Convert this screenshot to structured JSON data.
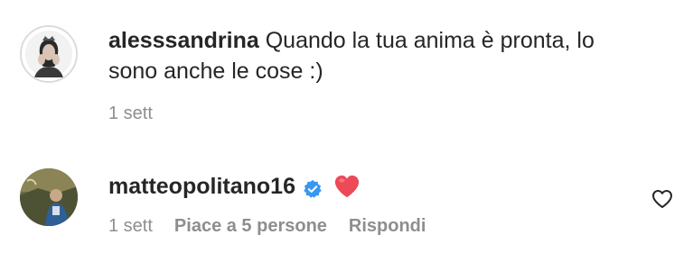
{
  "comments": [
    {
      "username": "alesssandrina",
      "text": "Quando la tua anima è pronta, lo sono anche le cose :)",
      "time": "1 sett",
      "avatar_icon": "profile-photo-icon",
      "has_story_ring": true
    },
    {
      "username": "matteopolitano16",
      "verified_icon": "verified-badge-icon",
      "emoji_icon": "red-heart-emoji-icon",
      "time": "1 sett",
      "likes_label": "Piace a 5 persone",
      "reply_label": "Rispondi",
      "avatar_icon": "profile-photo-icon",
      "like_icon": "heart-outline-icon"
    }
  ],
  "colors": {
    "text_primary": "#262626",
    "text_secondary": "#8e8e8e",
    "verified_blue": "#3897f0",
    "emoji_red": "#ed4956"
  }
}
